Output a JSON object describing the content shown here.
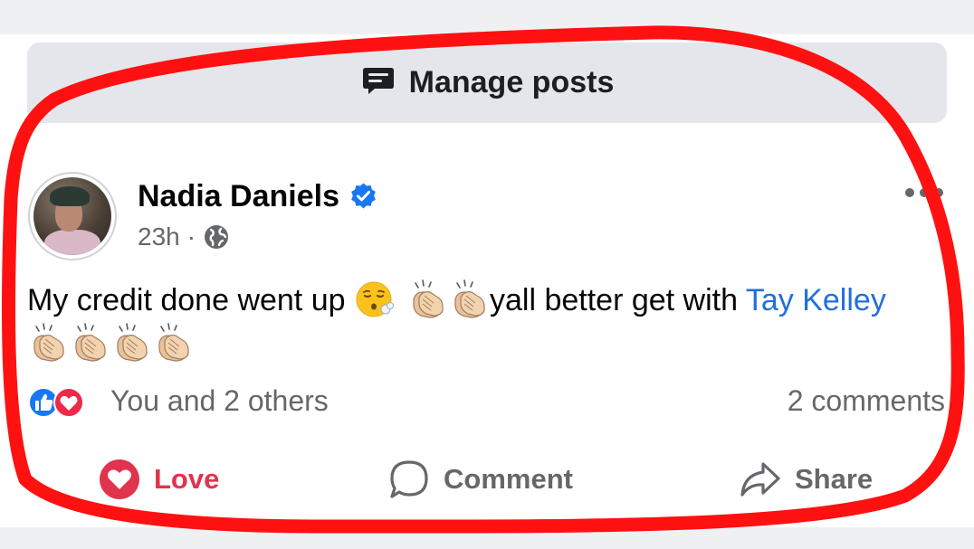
{
  "header": {
    "manage_label": "Manage posts",
    "manage_icon": "chat-bubble-icon"
  },
  "post": {
    "author": "Nadia Daniels",
    "verified": true,
    "time": "23h",
    "dot": "·",
    "audience_icon": "globe-icon",
    "text_part1": "My credit done went up",
    "text_part2": "yall better get with",
    "mention": "Tay Kelley",
    "emojis": [
      "face-exhaling",
      "clapping-hands",
      "clapping-hands",
      "clapping-hands",
      "clapping-hands",
      "clapping-hands",
      "clapping-hands"
    ],
    "reactions_label": "You and 2 others",
    "reaction_types": [
      "like",
      "love"
    ],
    "comments_label": "2 comments"
  },
  "actions": {
    "love": "Love",
    "comment": "Comment",
    "share": "Share"
  },
  "colors": {
    "accent_blue": "#216fdb",
    "love_red": "#e0334d",
    "annotation_red": "#ff0000"
  },
  "annotation": {
    "type": "hand-drawn red outline"
  }
}
